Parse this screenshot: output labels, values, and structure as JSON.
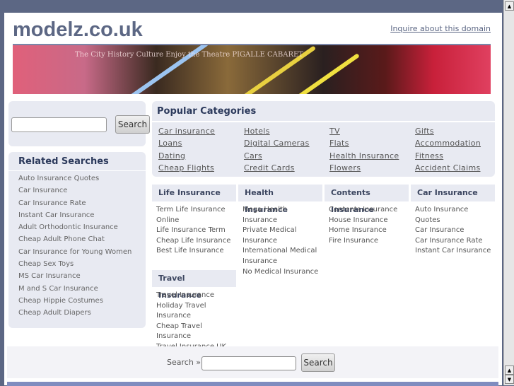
{
  "header": {
    "logo": "modelz.co.uk",
    "inquire": "Inquire about this domain"
  },
  "banner": {
    "text": "The City History Culture  Enjoy the Theatre  PIGALLE CABARET"
  },
  "search": {
    "button": "Search",
    "value": ""
  },
  "related": {
    "title": "Related Searches",
    "items": [
      "Auto Insurance Quotes",
      "Car Insurance",
      "Car Insurance Rate",
      "Instant Car Insurance",
      "Adult Orthodontic Insurance",
      "Cheap Adult Phone Chat",
      "Car Insurance for Young Women",
      "Cheap Sex Toys",
      "MS Car Insurance",
      "M and S Car Insurance",
      "Cheap Hippie Costumes",
      "Cheap Adult Diapers"
    ]
  },
  "popular": {
    "title": "Popular Categories",
    "links": [
      "Car insurance",
      "Hotels",
      "TV",
      "Gifts",
      "Loans",
      "Digital Cameras",
      "Flats",
      "Accommodation",
      "Dating",
      "Cars",
      "Health Insurance",
      "Fitness",
      "Cheap Flights",
      "Credit Cards",
      "Flowers",
      "Accident Claims"
    ]
  },
  "categories": [
    {
      "title": "Life Insurance",
      "items": [
        "Term Life Insurance Online",
        "Life Insurance Term",
        "Cheap Life Insurance",
        "Best Life Insurance"
      ]
    },
    {
      "title": "Health Insurance",
      "items": [
        "Mega Health Insurance",
        "Private Medical Insurance",
        "International Medical Insurance",
        "No Medical Insurance"
      ]
    },
    {
      "title": "Contents Insurance",
      "items": [
        "Contents Insurance",
        "House Insurance",
        "Home Insurance",
        "Fire Insurance"
      ]
    },
    {
      "title": "Car Insurance",
      "items": [
        "Auto Insurance Quotes",
        "Car Insurance",
        "Car Insurance Rate",
        "Instant Car Insurance"
      ]
    },
    {
      "title": "Travel Insurance",
      "items": [
        "Travel Insurance",
        "Holiday Travel Insurance",
        "Cheap Travel Insurance",
        "Travel Insurance UK"
      ]
    }
  ],
  "bottom_search": {
    "label": "Search »",
    "button": "Search",
    "value": ""
  }
}
